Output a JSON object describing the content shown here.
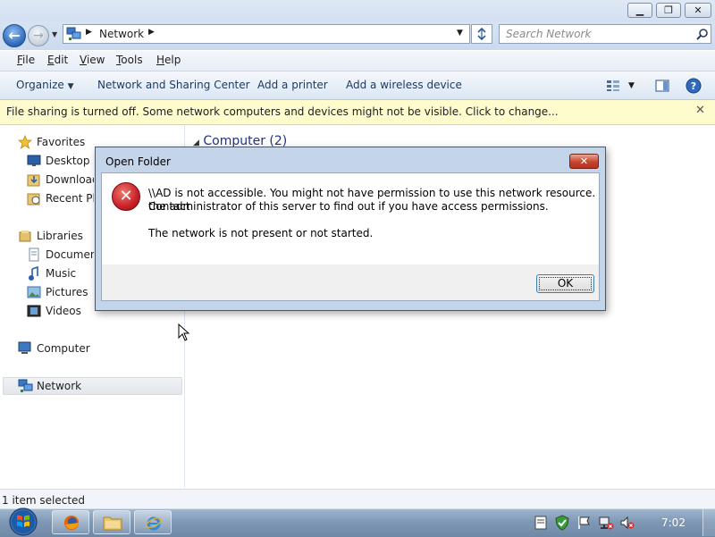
{
  "window": {
    "minimize_glyph": "▁",
    "maximize_glyph": "❐",
    "close_glyph": "✕"
  },
  "address_bar": {
    "back_glyph": "←",
    "forward_glyph": "→",
    "breadcrumb": "Network",
    "search_placeholder": "Search Network"
  },
  "menu": {
    "items": [
      {
        "first": "F",
        "rest": "ile"
      },
      {
        "first": "E",
        "rest": "dit"
      },
      {
        "first": "V",
        "rest": "iew"
      },
      {
        "first": "T",
        "rest": "ools"
      },
      {
        "first": "H",
        "rest": "elp"
      }
    ]
  },
  "command_bar": {
    "organize": "Organize",
    "network_sharing": "Network and Sharing Center",
    "add_printer": "Add a printer",
    "add_wireless": "Add a wireless device"
  },
  "info_bar": {
    "message": "File sharing is turned off. Some network computers and devices might not be visible. Click to change...",
    "close_glyph": "✕"
  },
  "nav_pane": {
    "favorites": "Favorites",
    "desktop": "Desktop",
    "downloads": "Download",
    "recent": "Recent Pla",
    "libraries": "Libraries",
    "documents": "Document",
    "music": "Music",
    "pictures": "Pictures",
    "videos": "Videos",
    "computer": "Computer",
    "network": "Network"
  },
  "content": {
    "group_header": "Computer (2)"
  },
  "status_bar": {
    "text": "1 item selected"
  },
  "taskbar": {
    "clock": "7:02"
  },
  "dialog": {
    "title": "Open Folder",
    "close_glyph": "✕",
    "error_glyph": "✕",
    "message_line1": "\\\\AD is not accessible. You might not have permission to use this network resource. Contact",
    "message_line2": "the administrator of this server to find out if you have access permissions.",
    "message_line3": "The network is not present or not started.",
    "ok_label": "OK"
  },
  "colors": {
    "accent": "#1e395b",
    "info_bar_bg": "#fefccd",
    "error_red": "#c8202a",
    "link_blue": "#1e3287"
  }
}
